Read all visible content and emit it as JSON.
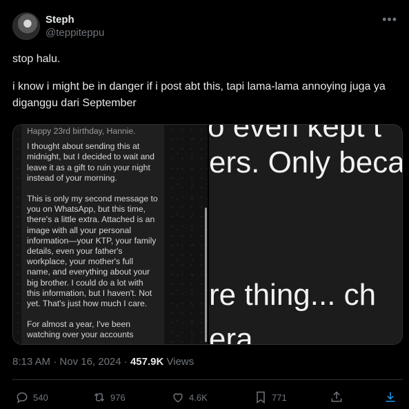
{
  "author": {
    "name": "Steph",
    "handle": "@teppiteppu",
    "more_icon": "more-horizontal-icon"
  },
  "tweet": {
    "line1": "stop halu.",
    "line2": "i know i might be in danger if i post abt this, tapi lama-lama annoying juga ya diganggu dari September"
  },
  "media": {
    "left_message": {
      "partial_top": "Happy 23rd birthday, Hannie.",
      "para1": "I thought about sending this at midnight, but I decided to wait and leave it as a gift to ruin your night instead of your morning.",
      "para2": "This is only my second message to you on WhatsApp, but this time, there's a little extra. Attached is an image with all your personal information—your KTP, your family details, even your father's workplace, your mother's full name, and everything about your big brother. I could do a lot with this information, but I haven't. Not yet. That's just how much I care.",
      "para3": "For almost a year, I've been watching over your accounts"
    },
    "right_text": {
      "line1": "o even kept t",
      "line2": "ers. Only beca",
      "line3": "re thing... ch",
      "line4": "era"
    }
  },
  "meta": {
    "time": "8:13 AM",
    "dot1": "·",
    "date": "Nov 16, 2024",
    "dot2": "·",
    "views_count": "457.9K",
    "views_label": "Views"
  },
  "actions": {
    "replies": "540",
    "reposts": "976",
    "likes": "4.6K",
    "bookmarks": "771"
  },
  "colors": {
    "background": "#000000",
    "text": "#e7e9ea",
    "muted": "#71767b",
    "accent": "#1d9bf0"
  }
}
